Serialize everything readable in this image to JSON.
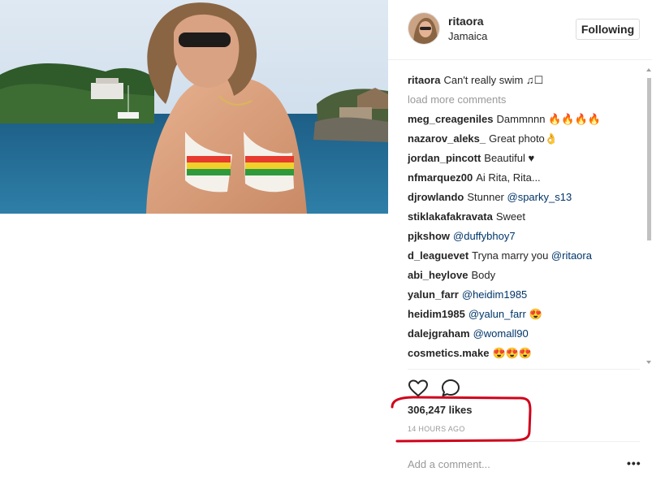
{
  "post": {
    "username": "ritaora",
    "location": "Jamaica",
    "follow_label": "Following",
    "likes": "306,247 likes",
    "time": "14 HOURS AGO",
    "load_more": "load more comments",
    "add_comment_placeholder": "Add a comment...",
    "more_label": "•••"
  },
  "comments": [
    {
      "user": "ritaora",
      "text": "Can't really swim ♫☐"
    },
    {
      "user": "meg_creageniles",
      "text": "Dammnnn 🔥🔥🔥🔥"
    },
    {
      "user": "nazarov_aleks_",
      "text": "Great photo👌"
    },
    {
      "user": "jordan_pincott",
      "text": "Beautiful ♥"
    },
    {
      "user": "nfmarquez00",
      "text": "Ai Rita, Rita..."
    },
    {
      "user": "djrowlando",
      "text": "Stunner ",
      "mention": "@sparky_s13"
    },
    {
      "user": "stiklakafakravata",
      "text": "Sweet"
    },
    {
      "user": "pjkshow",
      "text": "",
      "mention": "@duffybhoy7"
    },
    {
      "user": "d_leaguevet",
      "text": "Tryna marry you ",
      "mention": "@ritaora"
    },
    {
      "user": "abi_heylove",
      "text": "Body"
    },
    {
      "user": "yalun_farr",
      "text": "",
      "mention": "@heidim1985"
    },
    {
      "user": "heidim1985",
      "text": "",
      "mention": "@yalun_farr",
      "after": " 😍"
    },
    {
      "user": "dalejgraham",
      "text": "",
      "mention": "@womall90"
    },
    {
      "user": "cosmetics.make",
      "text": "😍😍😍"
    }
  ],
  "icons": {
    "heart": "heart-icon",
    "comment": "comment-icon",
    "more": "more-options-icon"
  },
  "colors": {
    "mention": "#003569",
    "highlight": "#d0021b",
    "muted": "#999999"
  }
}
